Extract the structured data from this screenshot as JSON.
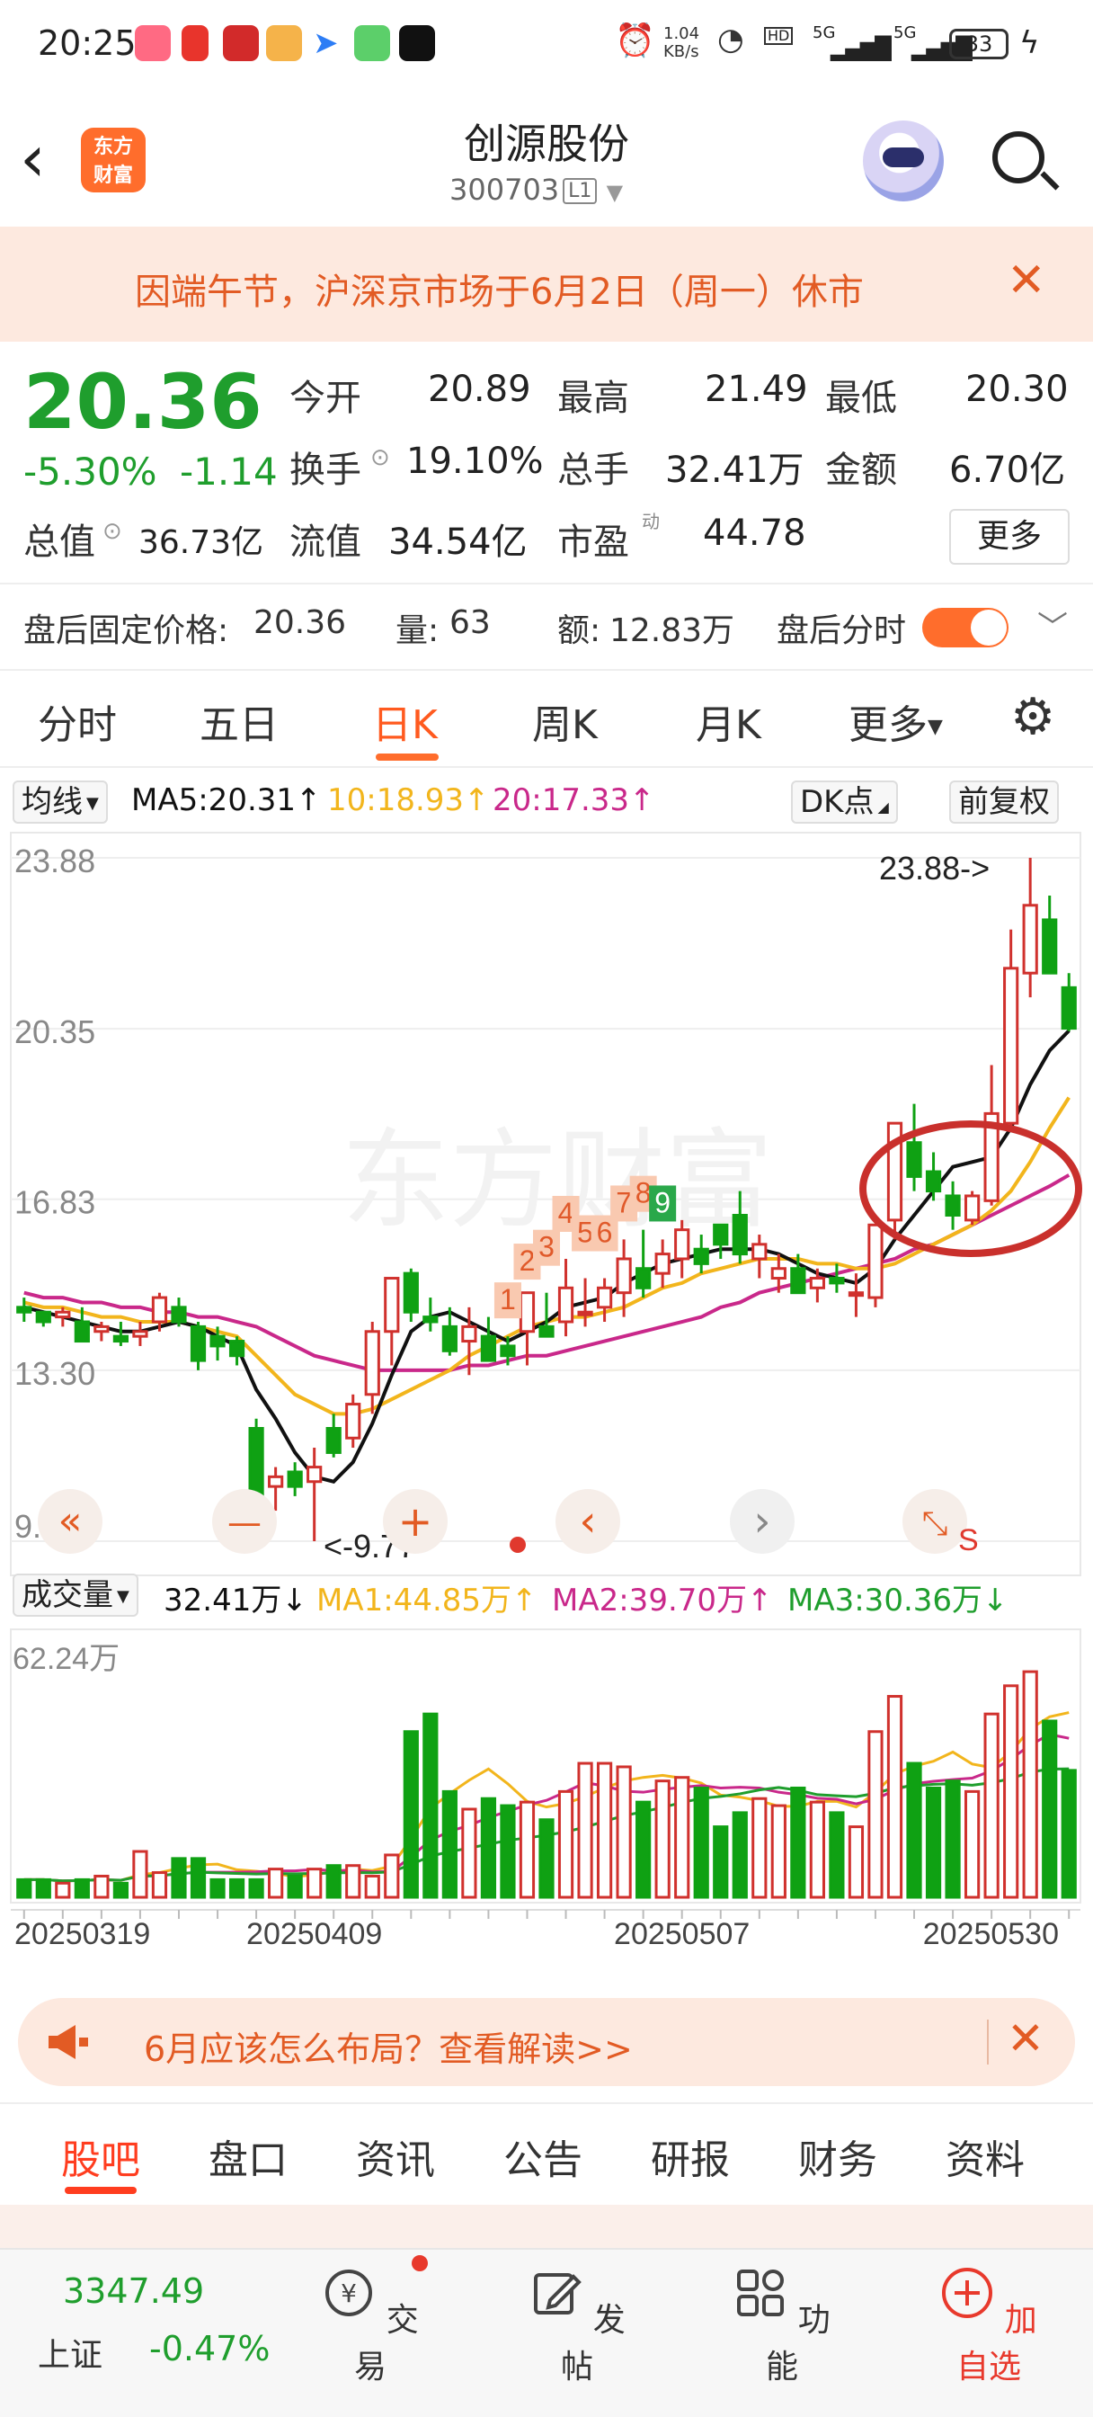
{
  "status_bar": {
    "time": "20:25",
    "net_speed_value": "1.04",
    "net_speed_unit": "KB/s",
    "signal_label_1": "5G",
    "signal_label_2": "5G",
    "battery": "33"
  },
  "header": {
    "logo_text_1": "东方",
    "logo_text_2": "财富",
    "stock_name": "创源股份",
    "stock_code": "300703",
    "level": "L1"
  },
  "notice": {
    "text": "因端午节，沪深京市场于6月2日（周一）休市"
  },
  "quote": {
    "price": "20.36",
    "change_pct": "-5.30%",
    "change_abs": "-1.14",
    "open_label": "今开",
    "open_value": "20.89",
    "high_label": "最高",
    "high_value": "21.49",
    "low_label": "最低",
    "low_value": "20.30",
    "turnover_label": "换手",
    "turnover_value": "19.10%",
    "volume_label": "总手",
    "volume_value": "32.41万",
    "amount_label": "金额",
    "amount_value": "6.70亿",
    "mktcap_label": "总值",
    "mktcap_value": "36.73亿",
    "float_label": "流值",
    "float_value": "34.54亿",
    "pe_label": "市盈",
    "pe_sup": "动",
    "pe_value": "44.78",
    "more_label": "更多"
  },
  "after_hours": {
    "price_label": "盘后固定价格:",
    "price_value": "20.36",
    "vol_label": "量:",
    "vol_value": "63",
    "amt_label": "额:",
    "amt_value": "12.83万",
    "toggle_label": "盘后分时"
  },
  "chart_tabs": [
    "分时",
    "五日",
    "日K",
    "周K",
    "月K",
    "更多"
  ],
  "ma_line": {
    "selector": "均线",
    "ma5": "MA5:20.31↑",
    "ma10": "10:18.93↑",
    "ma20": "20:17.33↑",
    "dk": "DK点",
    "adjust": "前复权"
  },
  "chart_controls": {
    "prev": "«",
    "zoom_out": "—",
    "zoom_in": "+",
    "left": "‹",
    "right": "›",
    "s_label": "S"
  },
  "volume_line": {
    "selector": "成交量",
    "vol": "32.41万↓",
    "ma1": "MA1:44.85万↑",
    "ma2": "MA2:39.70万↑",
    "ma3": "MA3:30.36万↓",
    "axis_max": "62.24万"
  },
  "dates": [
    "20250319",
    "20250409",
    "20250507",
    "20250530"
  ],
  "chart_data": {
    "type": "candlestick",
    "y_ticks": [
      "23.88",
      "20.35",
      "16.83",
      "13.30",
      "9.77"
    ],
    "ylim": [
      9.77,
      23.88
    ],
    "max_label": "23.88->",
    "min_label": "<-9.77",
    "nine_turn_labels": [
      "1",
      "2",
      "3",
      "4",
      "5",
      "6",
      "7",
      "8",
      "9"
    ],
    "candles": [
      [
        14.6,
        14.8,
        14.3,
        14.5
      ],
      [
        14.5,
        14.5,
        14.2,
        14.3
      ],
      [
        14.4,
        14.6,
        14.2,
        14.5
      ],
      [
        14.3,
        14.6,
        14.0,
        13.9
      ],
      [
        14.1,
        14.3,
        13.9,
        14.2
      ],
      [
        14.0,
        14.3,
        13.8,
        13.9
      ],
      [
        14.0,
        14.3,
        13.8,
        14.1
      ],
      [
        14.3,
        14.9,
        14.1,
        14.8
      ],
      [
        14.6,
        14.8,
        14.2,
        14.3
      ],
      [
        14.2,
        14.3,
        13.3,
        13.5
      ],
      [
        14.0,
        14.2,
        13.5,
        13.8
      ],
      [
        13.9,
        14.0,
        13.4,
        13.6
      ],
      [
        12.1,
        12.3,
        10.5,
        10.5
      ],
      [
        10.9,
        11.3,
        10.4,
        11.1
      ],
      [
        11.2,
        11.4,
        10.7,
        10.9
      ],
      [
        11.0,
        11.7,
        9.77,
        11.3
      ],
      [
        12.1,
        12.4,
        11.5,
        11.6
      ],
      [
        11.9,
        12.8,
        11.7,
        12.6
      ],
      [
        12.8,
        14.3,
        12.4,
        14.1
      ],
      [
        14.1,
        15.2,
        13.4,
        15.2
      ],
      [
        15.3,
        15.4,
        14.3,
        14.5
      ],
      [
        14.4,
        14.8,
        14.1,
        14.3
      ],
      [
        14.2,
        14.6,
        13.6,
        13.7
      ],
      [
        13.9,
        14.6,
        13.2,
        14.2
      ],
      [
        14.0,
        14.4,
        13.5,
        13.5
      ],
      [
        13.8,
        14.0,
        13.4,
        13.6
      ],
      [
        14.1,
        14.8,
        13.4,
        14.9
      ],
      [
        14.2,
        14.9,
        14.0,
        14.0
      ],
      [
        14.3,
        15.6,
        14.0,
        15.0
      ],
      [
        14.5,
        15.2,
        14.2,
        14.5
      ],
      [
        14.6,
        15.2,
        14.3,
        15.0
      ],
      [
        14.9,
        16.0,
        14.4,
        15.6
      ],
      [
        15.4,
        16.2,
        14.8,
        15.0
      ],
      [
        15.3,
        16.0,
        15.0,
        15.7
      ],
      [
        15.6,
        16.4,
        15.2,
        16.2
      ],
      [
        15.8,
        16.1,
        15.3,
        15.5
      ],
      [
        16.3,
        16.3,
        15.6,
        15.9
      ],
      [
        16.5,
        17.0,
        15.5,
        15.7
      ],
      [
        15.6,
        16.1,
        15.2,
        15.9
      ],
      [
        15.2,
        15.7,
        14.9,
        15.4
      ],
      [
        15.4,
        15.7,
        14.9,
        14.9
      ],
      [
        15.0,
        15.4,
        14.7,
        15.2
      ],
      [
        15.2,
        15.5,
        14.9,
        15.1
      ],
      [
        14.9,
        15.3,
        14.4,
        14.9
      ],
      [
        14.8,
        16.3,
        14.6,
        16.3
      ],
      [
        16.4,
        18.4,
        16.0,
        18.4
      ],
      [
        18.0,
        18.8,
        17.0,
        17.3
      ],
      [
        17.4,
        17.8,
        16.8,
        17.0
      ],
      [
        16.9,
        17.2,
        16.2,
        16.5
      ],
      [
        16.4,
        17.0,
        16.3,
        16.9
      ],
      [
        16.8,
        19.6,
        16.7,
        18.6
      ],
      [
        18.4,
        22.4,
        18.3,
        21.6
      ],
      [
        21.5,
        23.88,
        21.0,
        22.9
      ],
      [
        22.6,
        23.1,
        21.8,
        21.5
      ],
      [
        21.2,
        21.5,
        20.3,
        20.36
      ]
    ],
    "ma5": [
      14.6,
      14.5,
      14.4,
      14.3,
      14.2,
      14.1,
      14.1,
      14.2,
      14.3,
      14.2,
      14.0,
      13.8,
      12.9,
      12.3,
      11.6,
      11.1,
      11.0,
      11.4,
      12.2,
      13.2,
      14.1,
      14.4,
      14.5,
      14.3,
      14.1,
      13.9,
      14.1,
      14.3,
      14.6,
      14.7,
      14.8,
      15.1,
      15.3,
      15.5,
      15.6,
      15.7,
      15.8,
      15.8,
      15.8,
      15.7,
      15.5,
      15.3,
      15.2,
      15.1,
      15.4,
      16.0,
      16.5,
      17.0,
      17.5,
      17.6,
      17.7,
      18.3,
      19.2,
      19.9,
      20.31
    ],
    "ma10": [
      14.7,
      14.6,
      14.6,
      14.5,
      14.4,
      14.4,
      14.3,
      14.3,
      14.3,
      14.2,
      14.1,
      14.0,
      13.6,
      13.2,
      12.8,
      12.6,
      12.4,
      12.4,
      12.5,
      12.7,
      12.9,
      13.1,
      13.3,
      13.6,
      13.8,
      14.0,
      14.2,
      14.3,
      14.4,
      14.4,
      14.5,
      14.6,
      14.8,
      15.0,
      15.1,
      15.3,
      15.4,
      15.5,
      15.6,
      15.6,
      15.6,
      15.5,
      15.5,
      15.4,
      15.4,
      15.5,
      15.7,
      15.9,
      16.1,
      16.3,
      16.6,
      17.0,
      17.6,
      18.3,
      18.93
    ],
    "ma20": [
      14.9,
      14.8,
      14.8,
      14.7,
      14.7,
      14.6,
      14.6,
      14.5,
      14.5,
      14.4,
      14.4,
      14.3,
      14.2,
      14.0,
      13.8,
      13.6,
      13.5,
      13.4,
      13.3,
      13.3,
      13.3,
      13.3,
      13.3,
      13.4,
      13.4,
      13.5,
      13.6,
      13.6,
      13.7,
      13.8,
      13.9,
      14.0,
      14.1,
      14.2,
      14.3,
      14.4,
      14.6,
      14.7,
      14.9,
      15.0,
      15.1,
      15.2,
      15.3,
      15.4,
      15.5,
      15.6,
      15.8,
      15.9,
      16.1,
      16.3,
      16.5,
      16.7,
      16.9,
      17.1,
      17.33
    ],
    "volume": {
      "ymax": 62.24,
      "values": [
        5,
        5,
        4,
        5,
        6,
        4,
        13,
        7,
        11,
        11,
        5,
        5,
        5,
        8,
        6,
        8,
        9,
        9,
        6,
        12,
        47,
        52,
        30,
        25,
        28,
        26,
        27,
        22,
        30,
        38,
        38,
        37,
        27,
        33,
        34,
        31,
        20,
        24,
        28,
        26,
        31,
        27,
        24,
        20,
        47,
        57,
        38,
        31,
        33,
        30,
        52,
        60,
        64,
        50,
        36
      ]
    }
  },
  "banner": {
    "text": "6月应该怎么布局？查看解读>>"
  },
  "bottom_tabs": [
    "股吧",
    "盘口",
    "资讯",
    "公告",
    "研报",
    "财务",
    "资料"
  ],
  "bottom_nav": {
    "index_value": "3347.49",
    "index_name": "上证",
    "index_change": "-0.47%",
    "trade": "交易",
    "post": "发帖",
    "functions": "功能",
    "watchlist": "加自选"
  },
  "colors": {
    "up": "#d0312d",
    "down": "#0fa113",
    "ma5": "#111111",
    "ma10": "#f2b51c",
    "ma20": "#c9288a",
    "accent": "#ff6d2c"
  }
}
